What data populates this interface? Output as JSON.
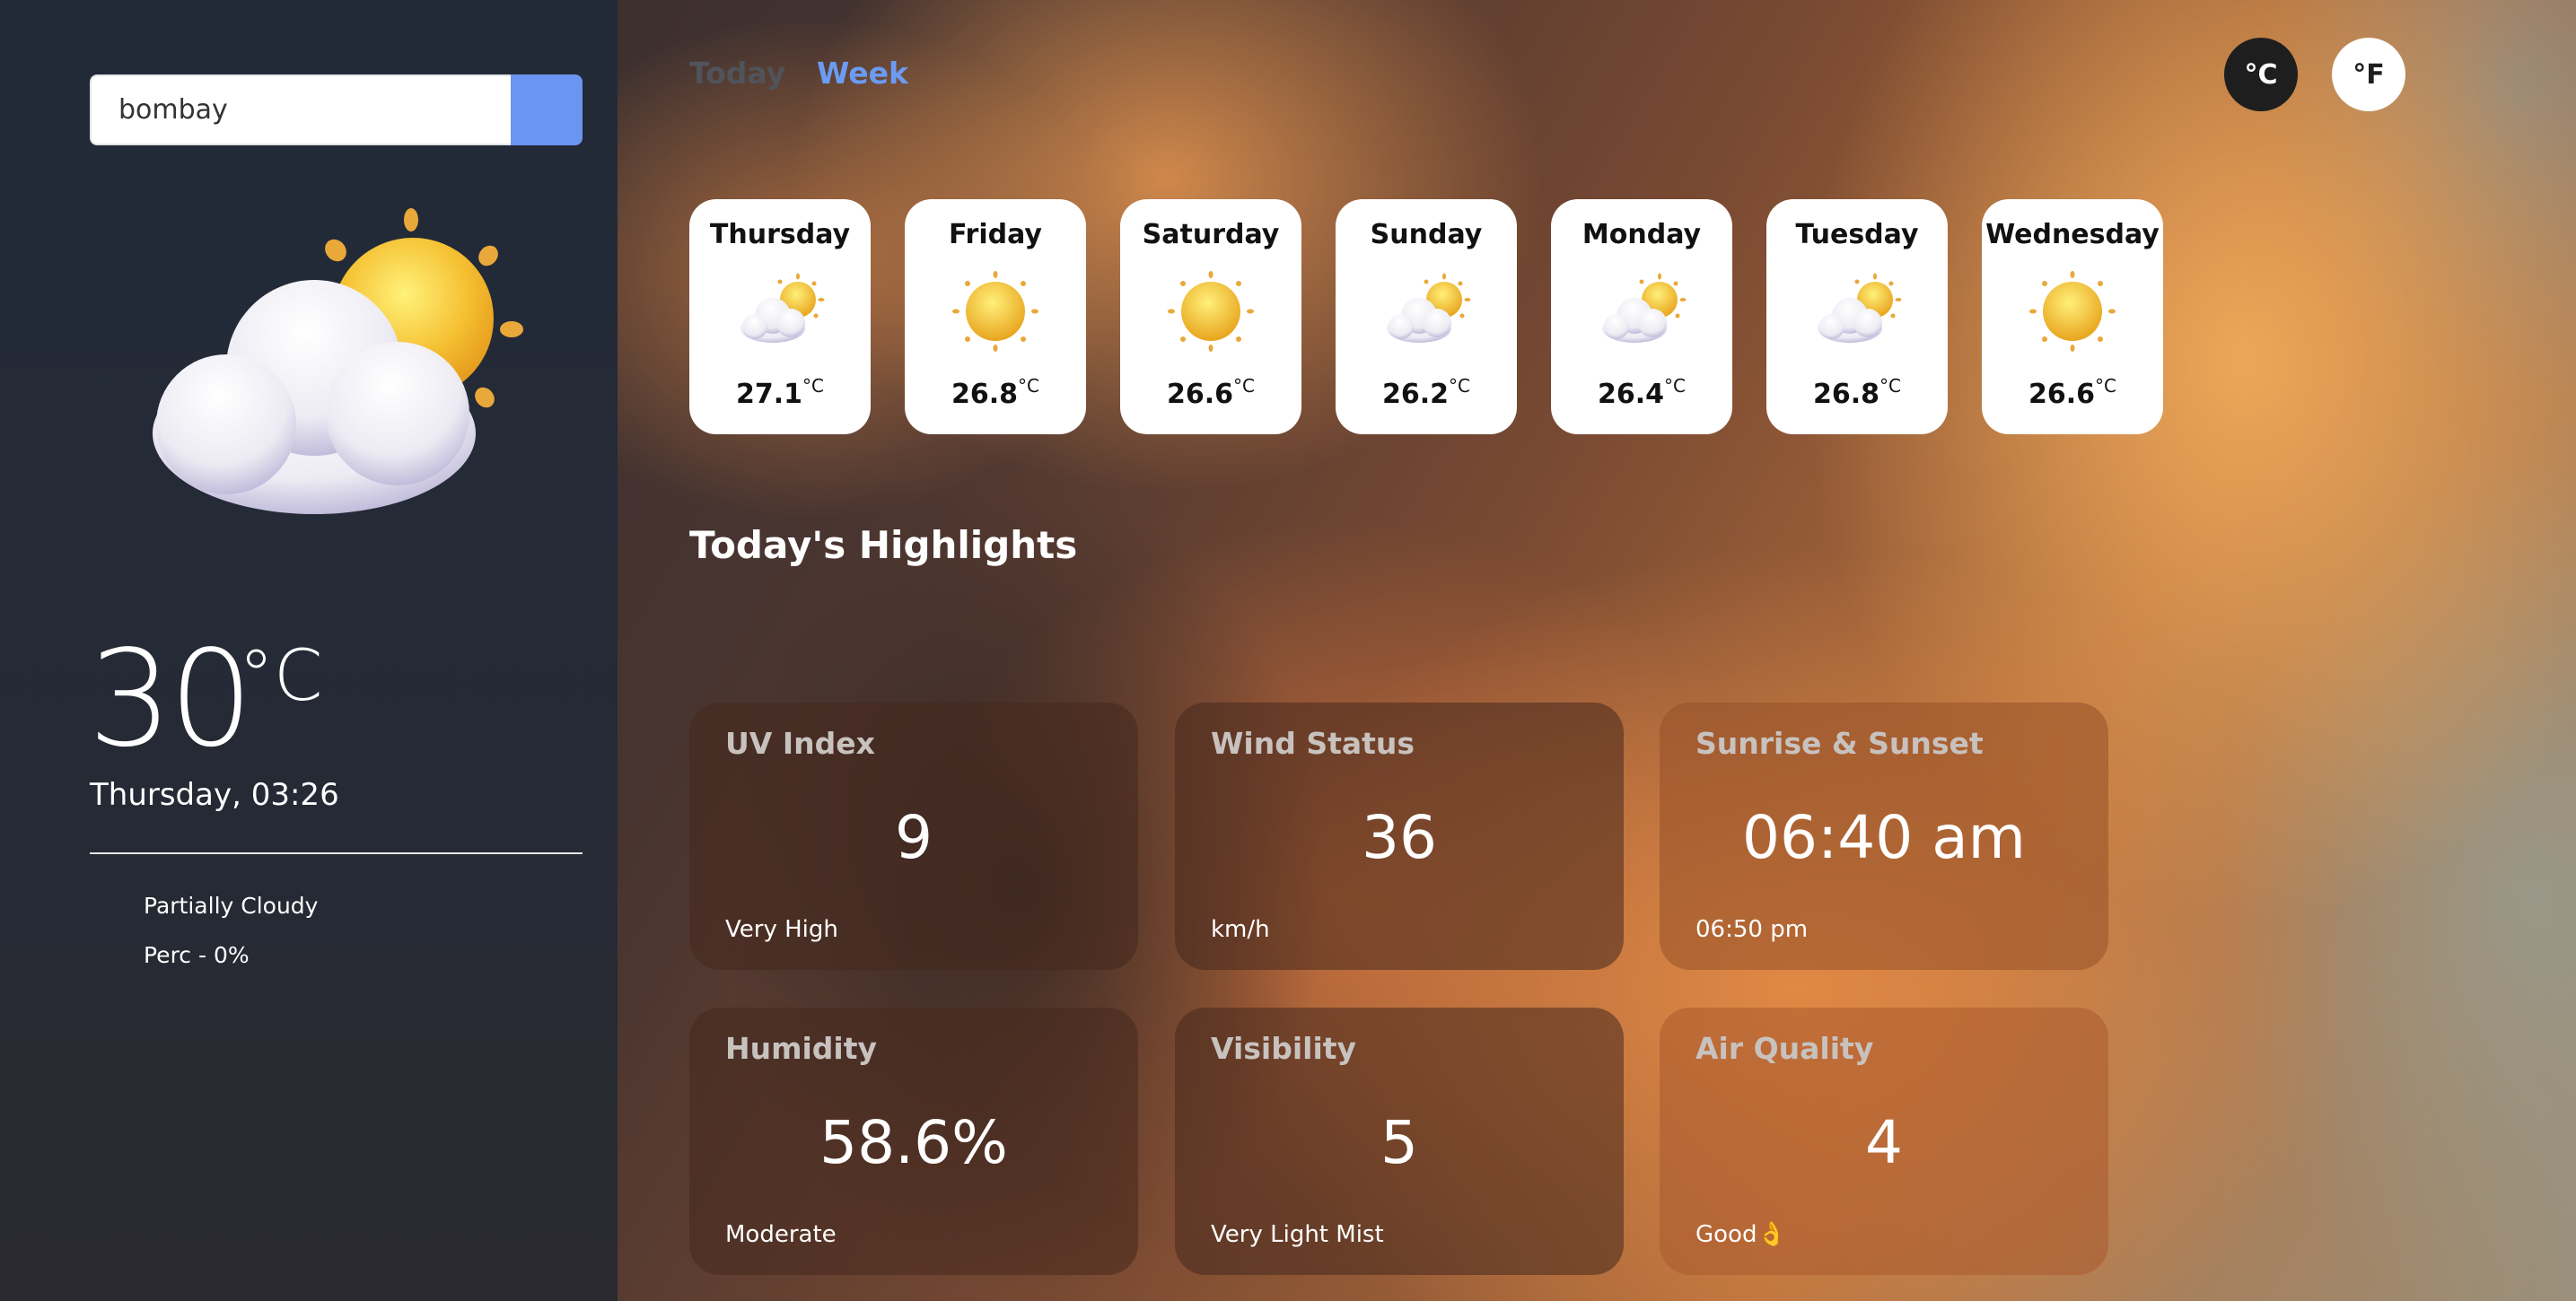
{
  "search": {
    "value": "bombay"
  },
  "current": {
    "temperature": "30",
    "unit": "°C",
    "datetime": "Thursday, 03:26",
    "condition": "Partially Cloudy",
    "precipitation": "Perc - 0%",
    "icon": "partly-cloudy-sun-icon"
  },
  "nav": {
    "today": "Today",
    "week": "Week",
    "active": "Week"
  },
  "units": {
    "celsius": "°C",
    "fahrenheit": "°F",
    "active": "°C"
  },
  "week": [
    {
      "day": "Thursday",
      "temp": "27.1",
      "unit": "°C",
      "icon": "partly-cloudy-icon"
    },
    {
      "day": "Friday",
      "temp": "26.8",
      "unit": "°C",
      "icon": "sun-icon"
    },
    {
      "day": "Saturday",
      "temp": "26.6",
      "unit": "°C",
      "icon": "sun-icon"
    },
    {
      "day": "Sunday",
      "temp": "26.2",
      "unit": "°C",
      "icon": "partly-cloudy-icon"
    },
    {
      "day": "Monday",
      "temp": "26.4",
      "unit": "°C",
      "icon": "partly-cloudy-icon"
    },
    {
      "day": "Tuesday",
      "temp": "26.8",
      "unit": "°C",
      "icon": "partly-cloudy-icon"
    },
    {
      "day": "Wednesday",
      "temp": "26.6",
      "unit": "°C",
      "icon": "sun-icon"
    }
  ],
  "highlights": {
    "title": "Today's Highlights",
    "cards": [
      {
        "title": "UV Index",
        "value": "9",
        "sub": "Very High"
      },
      {
        "title": "Wind Status",
        "value": "36",
        "sub": "km/h"
      },
      {
        "title": "Sunrise & Sunset",
        "value": "06:40 am",
        "sub": "06:50 pm"
      },
      {
        "title": "Humidity",
        "value": "58.6%",
        "sub": "Moderate"
      },
      {
        "title": "Visibility",
        "value": "5",
        "sub": "Very Light Mist"
      },
      {
        "title": "Air Quality",
        "value": "4",
        "sub": "Good👌"
      }
    ]
  },
  "colors": {
    "accent": "#6a95f0",
    "active_tab": "#6b9bf3",
    "inactive_tab": "#50535a"
  }
}
